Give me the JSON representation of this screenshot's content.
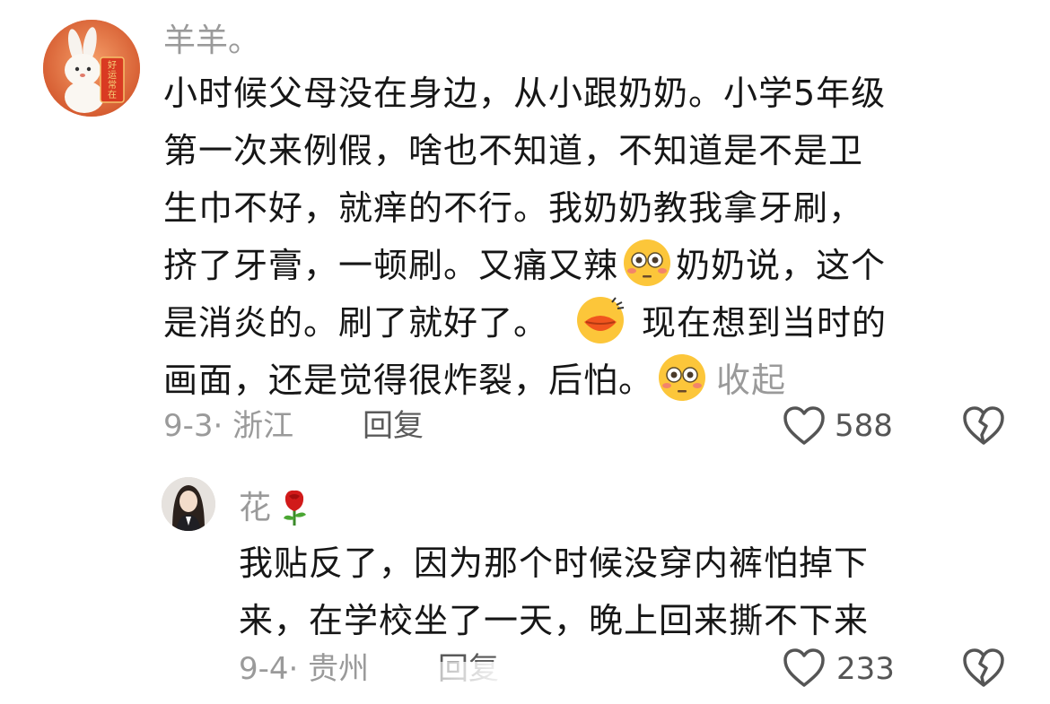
{
  "comment": {
    "username": "羊羊。",
    "lines": [
      "小时候父母没在身边，从小跟奶奶。小学5年级",
      "第一次来例假，啥也不知道，不知道是不是卫",
      "生巾不好，就痒的不行。我奶奶教我拿牙刷，",
      "挤了牙膏，一顿刷。又痛又辣",
      "奶奶说，这个",
      "是消炎的。刷了就好了。",
      "现在想到当时的",
      "画面，还是觉得很炸裂，后怕。"
    ],
    "collapse_label": "收起",
    "date_location": "9-3· 浙江",
    "reply_label": "回复",
    "like_count": "588",
    "avatar_sign_text": "好运常在"
  },
  "reply": {
    "username": "花",
    "lines": [
      "我贴反了，因为那个时候没穿内裤怕掉下",
      "来，在学校坐了一天，晚上回来撕不下来"
    ],
    "date_location": "9-4· 贵州",
    "reply_label": "回复",
    "like_count": "233"
  },
  "icons": {
    "like": "heart-outline-icon",
    "dislike": "broken-heart-outline-icon",
    "flushed_emoji": "flushed-face-emoji",
    "lips_emoji": "lips-emoji",
    "rose_emoji": "rose-emoji"
  },
  "colors": {
    "text": "#161616",
    "muted": "#9a9a9a"
  }
}
